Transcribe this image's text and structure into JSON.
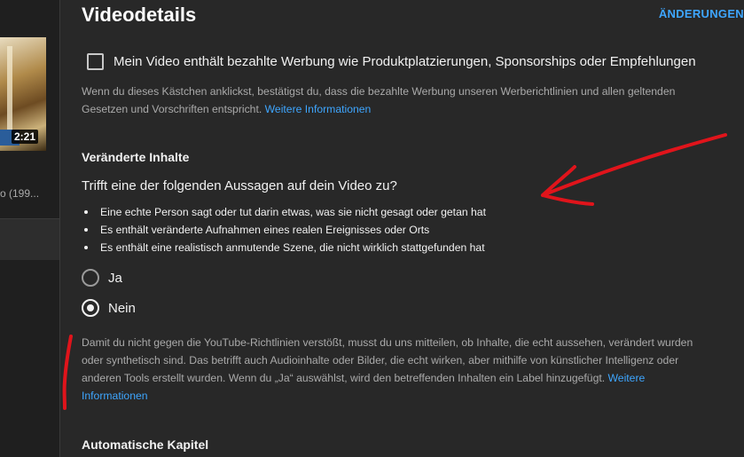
{
  "page": {
    "title": "Videodetails",
    "changes_link": "ÄNDERUNGEN"
  },
  "sidebar": {
    "video_duration": "2:21",
    "video_title_fragment": "o (199..."
  },
  "paid_promotion": {
    "checkbox_label": "Mein Video enthält bezahlte Werbung wie Produktplatzierungen, Sponsorships oder Empfehlungen",
    "checked": false,
    "help_text": "Wenn du dieses Kästchen anklickst, bestätigst du, dass die bezahlte Werbung unseren Werberichtlinien und allen geltenden Gesetzen und Vorschriften entspricht.",
    "help_link": "Weitere Informationen"
  },
  "altered_content": {
    "section_title": "Veränderte Inhalte",
    "question": "Trifft eine der folgenden Aussagen auf dein Video zu?",
    "bullets": [
      "Eine echte Person sagt oder tut darin etwas, was sie nicht gesagt oder getan hat",
      "Es enthält veränderte Aufnahmen eines realen Ereignisses oder Orts",
      "Es enthält eine realistisch anmutende Szene, die nicht wirklich stattgefunden hat"
    ],
    "options": {
      "yes": "Ja",
      "no": "Nein",
      "selected": "Nein"
    },
    "help_text": "Damit du nicht gegen die YouTube-Richtlinien verstößt, musst du uns mitteilen, ob Inhalte, die echt aussehen, verändert wurden oder synthetisch sind. Das betrifft auch Audioinhalte oder Bilder, die echt wirken, aber mithilfe von künstlicher Intelligenz oder anderen Tools erstellt wurden. Wenn du „Ja“ auswählst, wird den betreffenden Inhalten ein Label hinzugefügt.",
    "help_link": "Weitere Informationen"
  },
  "chapters": {
    "section_title": "Automatische Kapitel"
  },
  "colors": {
    "background": "#282828",
    "link": "#3ea6ff",
    "annotation": "#e0141b"
  }
}
